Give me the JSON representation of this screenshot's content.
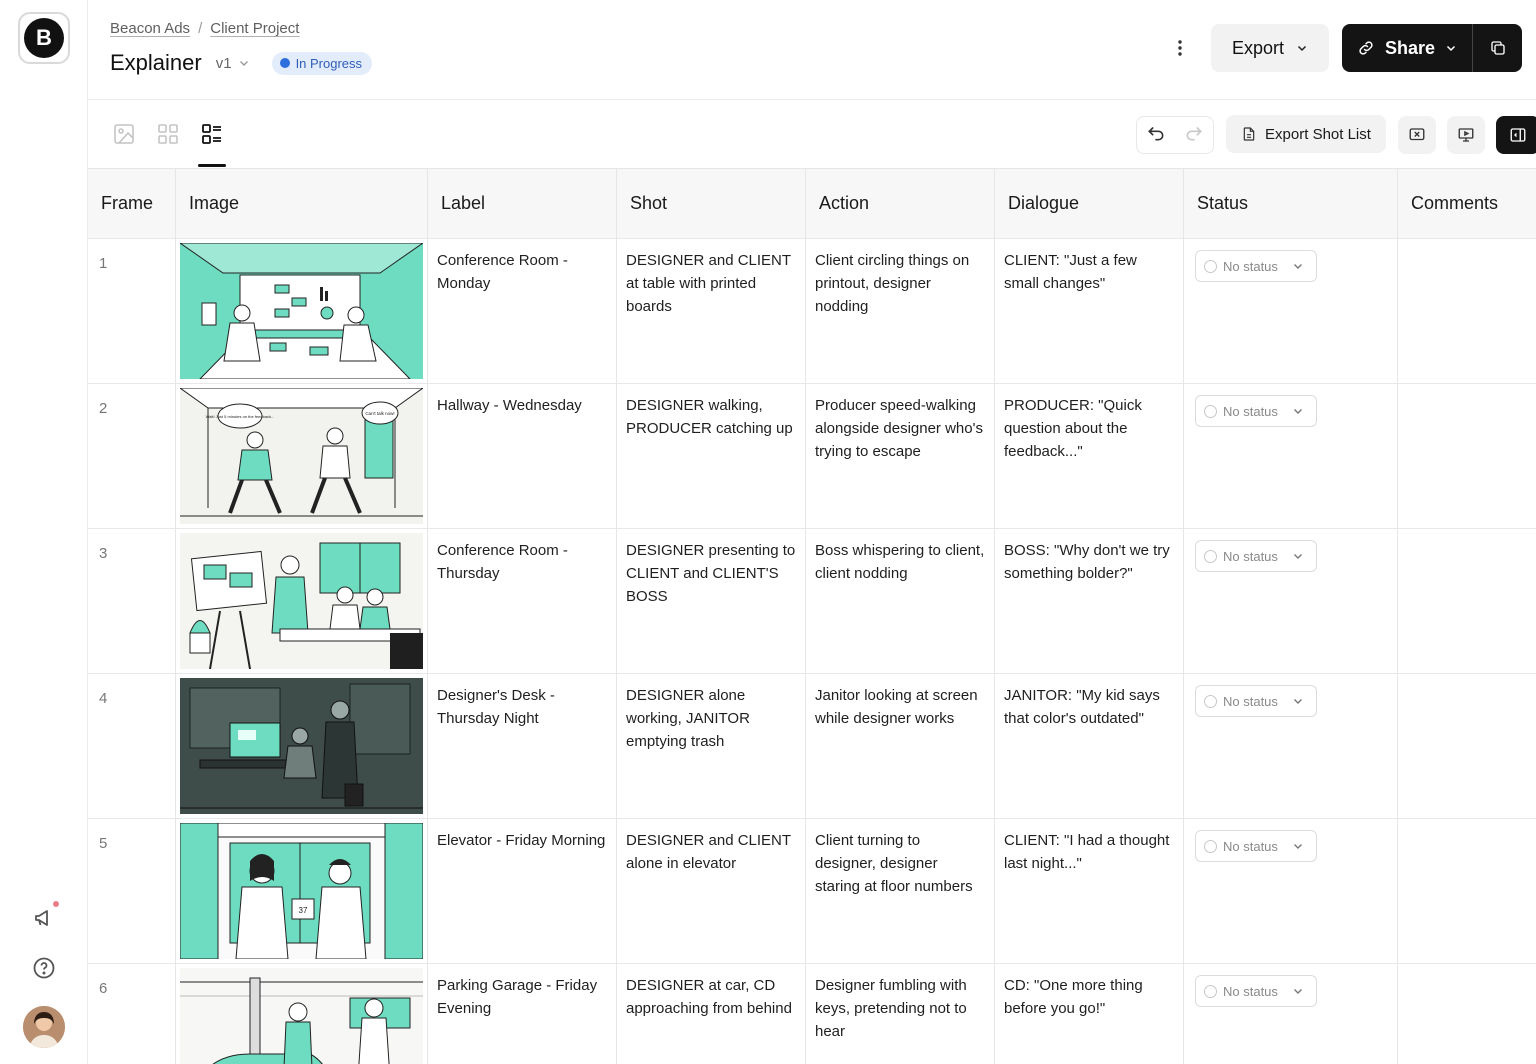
{
  "app": {
    "logo_letter": "B",
    "breadcrumb": [
      "Beacon Ads",
      "Client Project"
    ],
    "breadcrumb_sep": "/",
    "title": "Explainer",
    "version": "v1",
    "status_badge": "In Progress"
  },
  "header_actions": {
    "export_label": "Export",
    "share_label": "Share"
  },
  "toolbar": {
    "export_shot_list_label": "Export Shot List",
    "views": [
      "image-view-icon",
      "grid-view-icon",
      "list-view-icon"
    ],
    "active_view": "list"
  },
  "table": {
    "columns": [
      "Frame",
      "Image",
      "Label",
      "Shot",
      "Action",
      "Dialogue",
      "Status",
      "Comments"
    ],
    "status_placeholder": "No status",
    "rows": [
      {
        "frame": "1",
        "label": "Conference Room - Monday",
        "shot": "DESIGNER and CLIENT at table with printed boards",
        "action": "Client circling things on printout, designer nodding",
        "dialogue": "CLIENT: \"Just a few small changes\"",
        "status": "No status",
        "comments": ""
      },
      {
        "frame": "2",
        "label": "Hallway - Wednesday",
        "shot": "DESIGNER walking, PRODUCER catching up",
        "action": "Producer speed-walking alongside designer who's trying to escape",
        "dialogue": "PRODUCER: \"Quick question about the feedback...\"",
        "status": "No status",
        "comments": ""
      },
      {
        "frame": "3",
        "label": "Conference Room - Thursday",
        "shot": "DESIGNER presenting to CLIENT and CLIENT'S BOSS",
        "action": "Boss whispering to client, client nodding",
        "dialogue": "BOSS: \"Why don't we try something bolder?\"",
        "status": "No status",
        "comments": ""
      },
      {
        "frame": "4",
        "label": "Designer's Desk - Thursday Night",
        "shot": "DESIGNER alone working, JANITOR emptying trash",
        "action": "Janitor looking at screen while designer works",
        "dialogue": "JANITOR: \"My kid says that color's outdated\"",
        "status": "No status",
        "comments": ""
      },
      {
        "frame": "5",
        "label": "Elevator - Friday Morning",
        "shot": "DESIGNER and CLIENT alone in elevator",
        "action": "Client turning to designer, designer staring at floor numbers",
        "dialogue": "CLIENT: \"I had a thought last night...\"",
        "status": "No status",
        "comments": ""
      },
      {
        "frame": "6",
        "label": "Parking Garage - Friday Evening",
        "shot": "DESIGNER at car, CD approaching from behind",
        "action": "Designer fumbling with keys, pretending not to hear",
        "dialogue": "CD: \"One more thing before you go!\"",
        "status": "No status",
        "comments": ""
      }
    ],
    "thumbnail_speech": {
      "row2_left": "Wait! Just 5 minutes on the feedback...",
      "row2_right": "Can't talk now!",
      "row5_panel": "37"
    }
  },
  "colors": {
    "accent_mint": "#6ddcc0",
    "badge_bg": "#e3ecfb",
    "badge_text": "#2f5fb8",
    "badge_dot": "#2e6fde",
    "dark_button": "#141414",
    "notification_dot": "#f07b8c"
  }
}
